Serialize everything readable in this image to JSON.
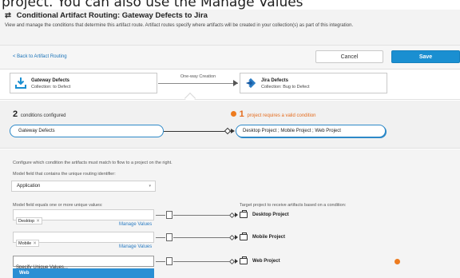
{
  "caption": "project. You can also use the Manage Values",
  "header": {
    "title": "Conditional Artifact Routing: Gateway Defects to Jira",
    "title_icon": "swap-arrows-icon",
    "description": "View and manage the conditions that determine this artifact route. Artifact routes specify where artifacts will be created in your collection(s) as part of this integration."
  },
  "toolbar": {
    "back_label": "< Back to Artifact Routing",
    "cancel_label": "Cancel",
    "save_label": "Save"
  },
  "flow": {
    "source": {
      "name": "Gateway Defects",
      "collection": "Collection: to Defect",
      "icon": "download-tray-icon"
    },
    "mode_label": "One-way Creation",
    "target": {
      "name": "Jira Defects",
      "collection": "Collection: Bug to Defect",
      "icon": "jira-logo-icon"
    }
  },
  "conditions": {
    "count": "2",
    "count_label": "conditions configured",
    "warn_count": "1",
    "warn_label": "project requires a valid condition",
    "source_pill": "Gateway Defects",
    "target_pill": "Desktop Project ; Mobile Project ; Web Project"
  },
  "config": {
    "intro": "Configure which condition the artifacts must match to flow to a project on the right.",
    "model_field_label": "Model field that contains the unique routing identifier:",
    "model_field_value": "Application",
    "values_label": "Model field equals one or more unique values:",
    "target_label": "Target project to receive artifacts based on a condition:",
    "manage_label": "Manage Values",
    "rows": [
      {
        "tag": "Desktop",
        "project": "Desktop Project"
      },
      {
        "tag": "Mobile",
        "project": "Mobile Project"
      },
      {
        "placeholder": "Specify Unique Values...",
        "project": "Web Project"
      }
    ],
    "dropdown_option": "Web"
  },
  "colors": {
    "accent": "#1a8fd1",
    "warning": "#ed7b1f",
    "link": "#2b7cc3"
  }
}
